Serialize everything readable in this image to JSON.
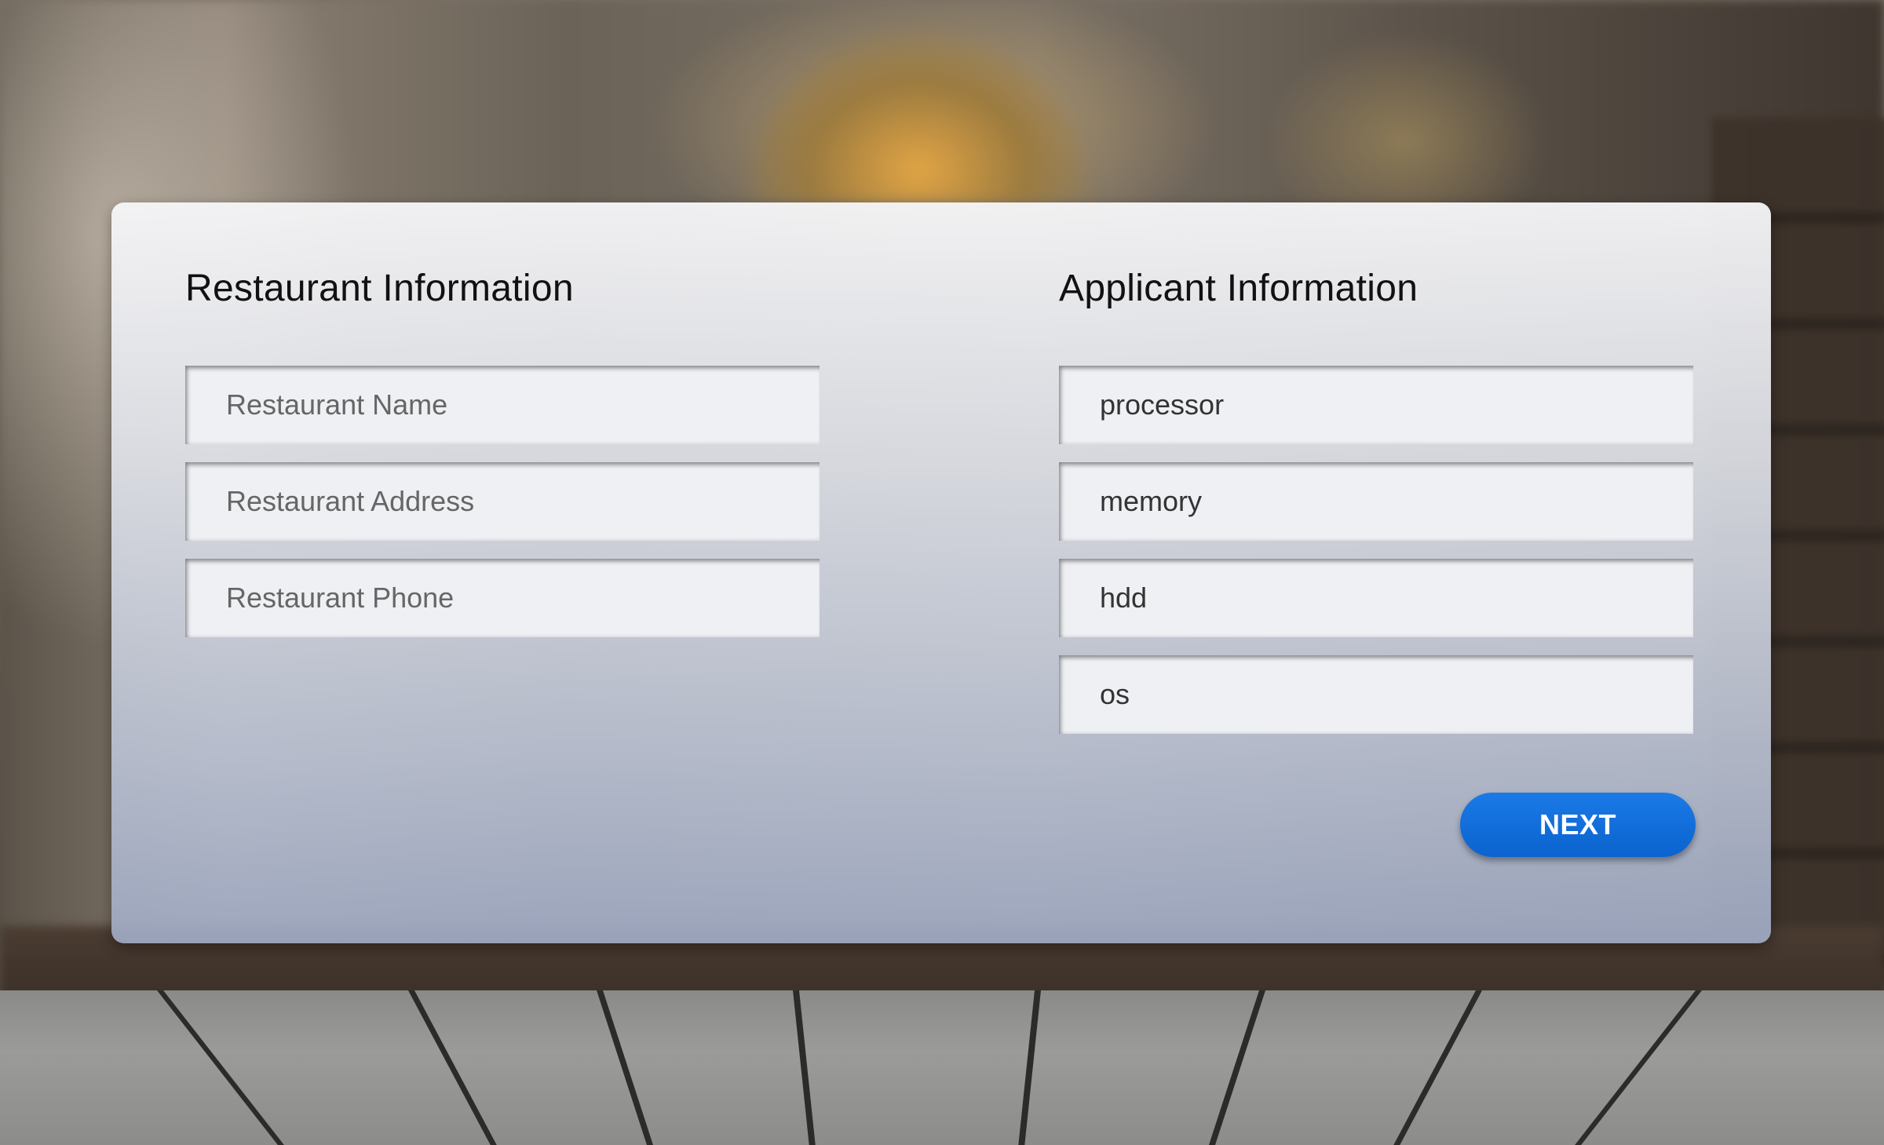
{
  "restaurant_section": {
    "title": "Restaurant Information",
    "fields": [
      {
        "placeholder": "Restaurant Name",
        "value": ""
      },
      {
        "placeholder": "Restaurant Address",
        "value": ""
      },
      {
        "placeholder": "Restaurant Phone",
        "value": ""
      }
    ]
  },
  "applicant_section": {
    "title": "Applicant Information",
    "fields": [
      {
        "placeholder": "",
        "value": "processor"
      },
      {
        "placeholder": "",
        "value": "memory"
      },
      {
        "placeholder": "",
        "value": "hdd"
      },
      {
        "placeholder": "",
        "value": "os"
      }
    ]
  },
  "actions": {
    "next_label": "NEXT"
  },
  "colors": {
    "accent": "#0b6fe0",
    "panel": "#e4e7ee"
  }
}
